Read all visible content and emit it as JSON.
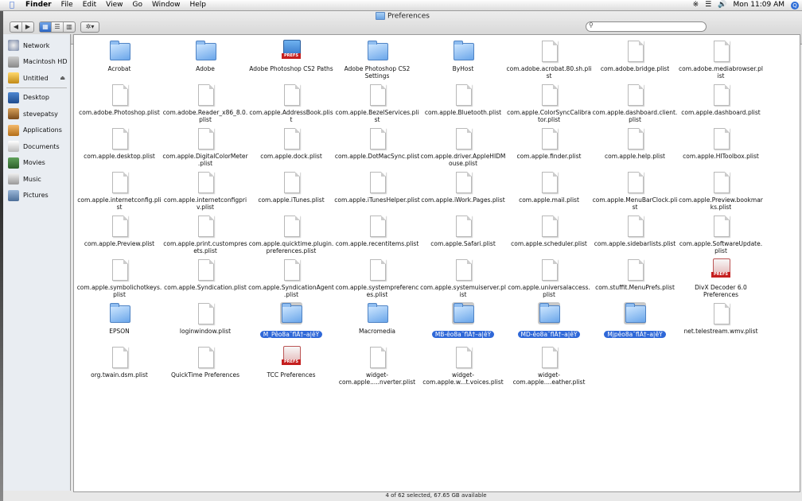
{
  "menubar": {
    "apple": "",
    "menus": [
      "Finder",
      "File",
      "Edit",
      "View",
      "Go",
      "Window",
      "Help"
    ],
    "clock": "Mon 11:09 AM",
    "spotlight": "Q"
  },
  "window": {
    "title": "Preferences",
    "status": "4 of 62 selected, 67.65 GB available",
    "search": {
      "value": "",
      "placeholder": ""
    }
  },
  "toolbar": {
    "back": "◀",
    "forward": "▶",
    "view_icon": "▦",
    "view_list": "☰",
    "view_column": "▥",
    "action": "✲▾"
  },
  "sidebar": {
    "devices": [
      {
        "label": "Network",
        "icon": "network-icon"
      },
      {
        "label": "Macintosh HD",
        "icon": "hard-drive-icon"
      },
      {
        "label": "Untitled",
        "icon": "disk-icon",
        "eject": "⏏"
      }
    ],
    "places": [
      {
        "label": "Desktop",
        "icon": "desktop-icon"
      },
      {
        "label": "stevepatsy",
        "icon": "home-icon"
      },
      {
        "label": "Applications",
        "icon": "applications-icon"
      },
      {
        "label": "Documents",
        "icon": "documents-icon"
      },
      {
        "label": "Movies",
        "icon": "movies-icon"
      },
      {
        "label": "Music",
        "icon": "music-icon"
      },
      {
        "label": "Pictures",
        "icon": "pictures-icon"
      }
    ]
  },
  "files": [
    {
      "label": "Acrobat",
      "kind": "folder"
    },
    {
      "label": "Adobe",
      "kind": "folder"
    },
    {
      "label": "Adobe Photoshop CS2 Paths",
      "kind": "prefs"
    },
    {
      "label": "Adobe Photoshop CS2 Settings",
      "kind": "folder"
    },
    {
      "label": "ByHost",
      "kind": "folder"
    },
    {
      "label": "com.adobe.acrobat.80.sh.plist",
      "kind": "doc"
    },
    {
      "label": "com.adobe.bridge.plist",
      "kind": "doc"
    },
    {
      "label": "com.adobe.mediabrowser.plist",
      "kind": "doc"
    },
    {
      "label": "com.adobe.Photoshop.plist",
      "kind": "doc"
    },
    {
      "label": "com.adobe.Reader_x86_8.0.plist",
      "kind": "doc"
    },
    {
      "label": "com.apple.AddressBook.plist",
      "kind": "doc"
    },
    {
      "label": "com.apple.BezelServices.plist",
      "kind": "doc"
    },
    {
      "label": "com.apple.Bluetooth.plist",
      "kind": "doc"
    },
    {
      "label": "com.apple.ColorSyncCalibrator.plist",
      "kind": "doc"
    },
    {
      "label": "com.apple.dashboard.client.plist",
      "kind": "doc"
    },
    {
      "label": "com.apple.dashboard.plist",
      "kind": "doc"
    },
    {
      "label": "com.apple.desktop.plist",
      "kind": "doc"
    },
    {
      "label": "com.apple.DigitalColorMeter.plist",
      "kind": "doc"
    },
    {
      "label": "com.apple.dock.plist",
      "kind": "doc"
    },
    {
      "label": "com.apple.DotMacSync.plist",
      "kind": "doc"
    },
    {
      "label": "com.apple.driver.AppleHIDMouse.plist",
      "kind": "doc"
    },
    {
      "label": "com.apple.finder.plist",
      "kind": "doc"
    },
    {
      "label": "com.apple.help.plist",
      "kind": "doc"
    },
    {
      "label": "com.apple.HIToolbox.plist",
      "kind": "doc"
    },
    {
      "label": "com.apple.internetconfig.plist",
      "kind": "doc"
    },
    {
      "label": "com.apple.internetconfigpriv.plist",
      "kind": "doc"
    },
    {
      "label": "com.apple.iTunes.plist",
      "kind": "doc"
    },
    {
      "label": "com.apple.iTunesHelper.plist",
      "kind": "doc"
    },
    {
      "label": "com.apple.iWork.Pages.plist",
      "kind": "doc"
    },
    {
      "label": "com.apple.mail.plist",
      "kind": "doc"
    },
    {
      "label": "com.apple.MenuBarClock.plist",
      "kind": "doc"
    },
    {
      "label": "com.apple.Preview.bookmarks.plist",
      "kind": "doc"
    },
    {
      "label": "com.apple.Preview.plist",
      "kind": "doc"
    },
    {
      "label": "com.apple.print.custompresets.plist",
      "kind": "doc"
    },
    {
      "label": "com.apple.quicktime.plugin.preferences.plist",
      "kind": "doc"
    },
    {
      "label": "com.apple.recentitems.plist",
      "kind": "doc"
    },
    {
      "label": "com.apple.Safari.plist",
      "kind": "doc"
    },
    {
      "label": "com.apple.scheduler.plist",
      "kind": "doc"
    },
    {
      "label": "com.apple.sidebarlists.plist",
      "kind": "doc"
    },
    {
      "label": "com.apple.SoftwareUpdate.plist",
      "kind": "doc"
    },
    {
      "label": "com.apple.symbolichotkeys.plist",
      "kind": "doc"
    },
    {
      "label": "com.apple.Syndication.plist",
      "kind": "doc"
    },
    {
      "label": "com.apple.SyndicationAgent.plist",
      "kind": "doc"
    },
    {
      "label": "com.apple.systempreferences.plist",
      "kind": "doc"
    },
    {
      "label": "com.apple.systemuiserver.plist",
      "kind": "doc"
    },
    {
      "label": "com.apple.universalaccess.plist",
      "kind": "doc"
    },
    {
      "label": "com.stuffit.MenuPrefs.plist",
      "kind": "doc"
    },
    {
      "label": "DivX Decoder 6.0 Preferences",
      "kind": "prefs-red"
    },
    {
      "label": "EPSON",
      "kind": "folder"
    },
    {
      "label": "loginwindow.plist",
      "kind": "doc"
    },
    {
      "label": "M_Pêo8a¯flÂ†–a|êŸ",
      "kind": "folder",
      "selected": true
    },
    {
      "label": "Macromedia",
      "kind": "folder"
    },
    {
      "label": "MB-êo8a¯flÂ†–a|êŸ",
      "kind": "folder",
      "selected": true
    },
    {
      "label": "MD-êo8a¯flÂ†–a|êŸ",
      "kind": "folder",
      "selected": true
    },
    {
      "label": "Mjpêo8a¯flÂ†–a|êŸ",
      "kind": "folder",
      "selected": true
    },
    {
      "label": "net.telestream.wmv.plist",
      "kind": "doc"
    },
    {
      "label": "org.twain.dsm.plist",
      "kind": "doc"
    },
    {
      "label": "QuickTime Preferences",
      "kind": "doc"
    },
    {
      "label": "TCC Preferences",
      "kind": "prefs-red"
    },
    {
      "label": "widget-com.apple.....nverter.plist",
      "kind": "doc"
    },
    {
      "label": "widget-com.apple.w...t.voices.plist",
      "kind": "doc"
    },
    {
      "label": "widget-com.apple....eather.plist",
      "kind": "doc"
    }
  ],
  "colors": {
    "selection": "#2f68d8",
    "folder": "#6aa6ea"
  }
}
